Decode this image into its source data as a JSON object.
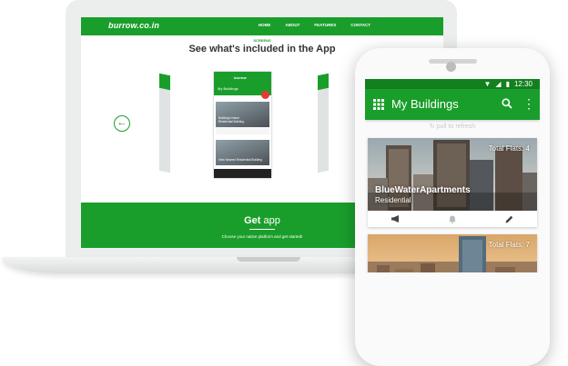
{
  "laptop_site": {
    "logo": "burrow.co.in",
    "nav": [
      "HOME",
      "ABOUT",
      "FEATURES",
      "CONTACT"
    ],
    "section_kicker": "SCREENS",
    "section_title": "See what's included in the App",
    "mini_app": {
      "logo": "burrow",
      "title": "My Buildings",
      "card1_label": "Building's Name",
      "card1_sub": "Residential Building",
      "card2_label": "View Nearest Residential Building"
    },
    "get_app": {
      "title_bold": "Get",
      "title_rest": " app",
      "subtitle": "Choose your native platform and get started!"
    }
  },
  "phone": {
    "status_time": "12:30",
    "app_title": "My Buildings",
    "refresh_text": "pull to refresh",
    "cards": [
      {
        "total_flats": "Total Flats: 4",
        "name": "BlueWaterApartments",
        "type": "Residential"
      },
      {
        "total_flats": "Total Flats: 7"
      }
    ]
  },
  "colors": {
    "brand_green": "#1a9e2b",
    "status_green": "#13801f",
    "fab_red": "#e53935"
  },
  "icons": [
    "back-arrow-icon",
    "grid-icon",
    "search-icon",
    "more-vert-icon",
    "megaphone-icon",
    "bell-icon",
    "pencil-icon",
    "refresh-icon",
    "wifi-icon",
    "signal-icon",
    "battery-icon"
  ]
}
